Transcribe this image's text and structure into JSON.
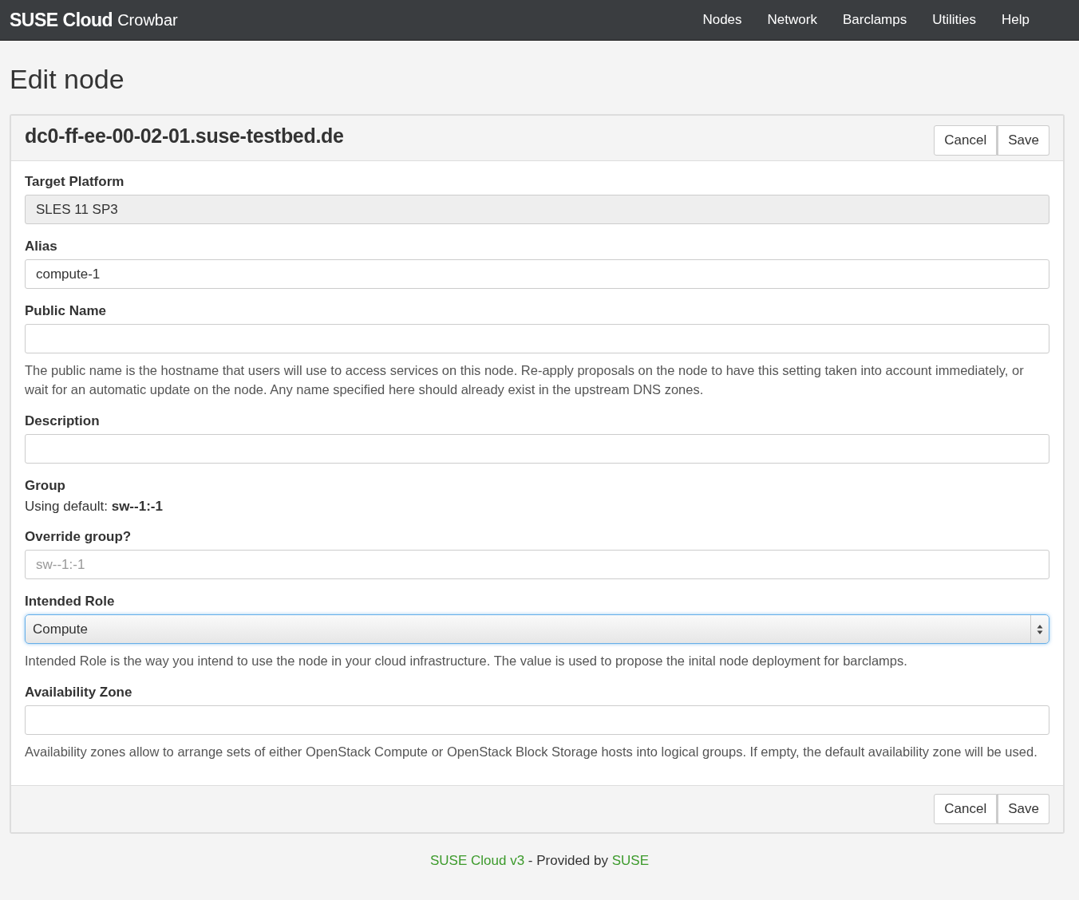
{
  "navbar": {
    "brand": "SUSE Cloud",
    "brand_sub": "Crowbar",
    "items": [
      "Nodes",
      "Network",
      "Barclamps",
      "Utilities",
      "Help"
    ]
  },
  "page_title": "Edit node",
  "panel": {
    "title": "dc0-ff-ee-00-02-01.suse-testbed.de",
    "header_buttons": [
      "Cancel",
      "Save"
    ],
    "fields": [
      {
        "kind": "input",
        "label": "Target Platform",
        "value": "SLES 11 SP3",
        "disabled": true
      },
      {
        "kind": "input",
        "label": "Alias",
        "value": "compute-1",
        "disabled": false
      },
      {
        "kind": "input",
        "label": "Public Name",
        "disabled": false,
        "help": "The public name is the hostname that users will use to access services on this node. Re-apply proposals on the node to have this setting taken into account immediately, or wait for an automatic update on the node. Any name specified here should already exist in the upstream DNS zones."
      },
      {
        "kind": "input",
        "label": "Description",
        "disabled": false
      },
      {
        "kind": "text",
        "label": "Group",
        "text": "Using default: **sw--1:-1**"
      },
      {
        "kind": "input",
        "label": "Override group?",
        "placeholder": "sw--1:-1",
        "disabled": false
      },
      {
        "kind": "select",
        "label": "Intended Role",
        "value": "Compute",
        "focused": true,
        "help": "Intended Role is the way you intend to use the node in your cloud infrastructure. The value is used to propose the inital node deployment for barclamps."
      },
      {
        "kind": "input",
        "label": "Availability Zone",
        "disabled": false,
        "help": "Availability zones allow to arrange sets of either OpenStack Compute or OpenStack Block Storage hosts into logical groups. If empty, the default availability zone will be used."
      }
    ],
    "footer_buttons": [
      "Cancel",
      "Save"
    ]
  },
  "footer": [
    {
      "text": "SUSE Cloud v3",
      "link": true
    },
    {
      "text": " - Provided by ",
      "link": false
    },
    {
      "text": "SUSE",
      "link": true
    }
  ]
}
